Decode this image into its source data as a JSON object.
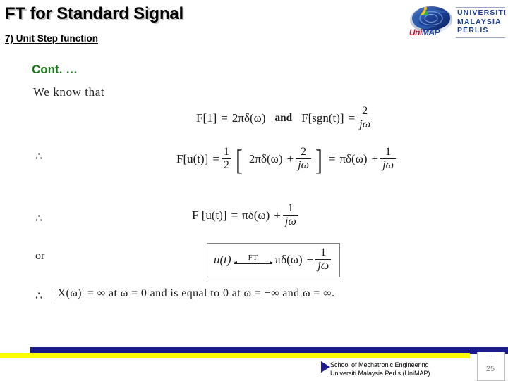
{
  "header": {
    "title": "FT for Standard Signal",
    "subtitle": "7) Unit Step function",
    "cont_label": "Cont. …"
  },
  "logo": {
    "wordmark_uni": "Uni",
    "wordmark_map": "MAP",
    "line1": "UNIVERSITI",
    "line2": "MALAYSIA",
    "line3": "PERLIS"
  },
  "body": {
    "intro": "We know that",
    "therefore_1": "∴",
    "therefore_2": "∴",
    "or_label": "or",
    "therefore_3": "∴"
  },
  "equations": {
    "eq1": {
      "lhs": "F[1]",
      "eq": "=",
      "rhs": "2πδ(ω)",
      "conj": "and",
      "lhs2": "F[sgn(t)]",
      "eq2": "=",
      "frac_num": "2",
      "frac_den": "jω"
    },
    "eq2": {
      "lhs": "F[u(t)]",
      "eq": "=",
      "half_num": "1",
      "half_den": "2",
      "bracket_open": "[",
      "term1": "2πδ(ω)",
      "plus": "+",
      "f1_num": "2",
      "f1_den": "jω",
      "bracket_close": "]",
      "eq2": "=",
      "term2": "πδ(ω)",
      "plus2": "+",
      "f2_num": "1",
      "f2_den": "jω"
    },
    "eq3": {
      "lhs": "F [u(t)]",
      "eq": "=",
      "rhs": "πδ(ω)",
      "plus": "+",
      "frac_num": "1",
      "frac_den": "jω"
    },
    "eq4_boxed": {
      "lhs": "u(t)",
      "arrow_label": "FT",
      "rhs": "πδ(ω)",
      "plus": "+",
      "frac_num": "1",
      "frac_den": "jω"
    },
    "eq5": "|X(ω)| = ∞ at ω = 0 and is equal to 0 at ω = −∞ and ω = ∞."
  },
  "footer": {
    "line1": "School of Mechatronic Engineering",
    "line2": "Universiti Malaysia Perlis (UniMAP)",
    "page_number": "25",
    "page_mark": "··"
  },
  "colors": {
    "title_text": "#000000",
    "cont_green": "#1a7a1a",
    "bar_blue": "#1b1b8f",
    "bar_yellow": "#ffff00",
    "logo_blue": "#1b3f94",
    "logo_red": "#c8102e"
  }
}
